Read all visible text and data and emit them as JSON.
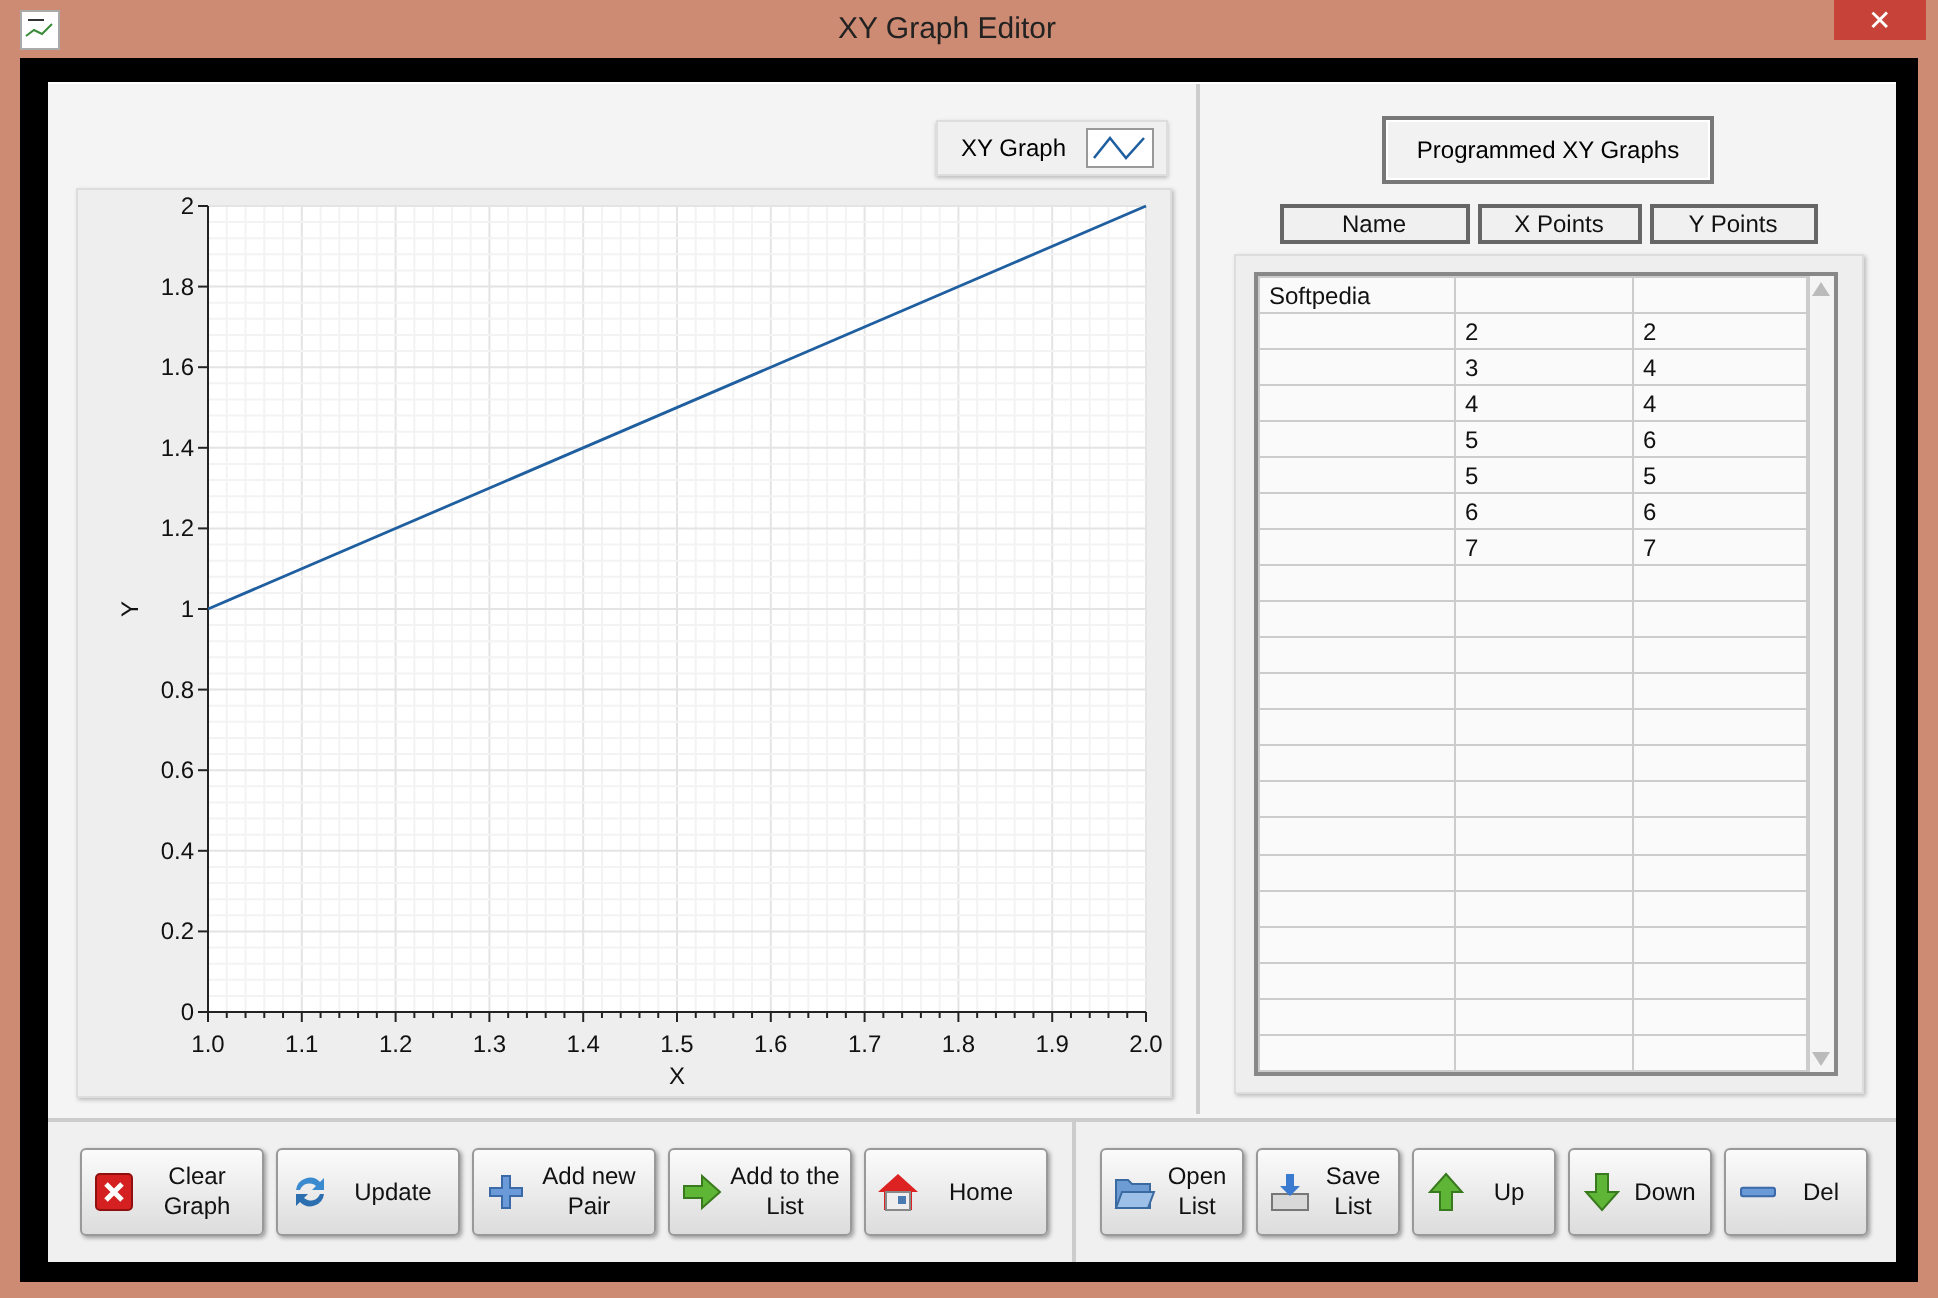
{
  "window": {
    "title": "XY Graph Editor",
    "close_button": "✕"
  },
  "graph": {
    "chart_data": {
      "type": "line",
      "grid": true,
      "xlabel": "X",
      "ylabel": "Y",
      "x": [
        1.0,
        2.0
      ],
      "series": [
        {
          "name": "XY Graph",
          "color": "#1f5fa0",
          "values": [
            1,
            2
          ]
        }
      ],
      "xlim": [
        1.0,
        2.0
      ],
      "ylim": [
        0,
        2
      ],
      "xticks": [
        {
          "value": 1.0,
          "label": "1.0"
        },
        {
          "value": 1.1,
          "label": "1.1"
        },
        {
          "value": 1.2,
          "label": "1.2"
        },
        {
          "value": 1.3,
          "label": "1.3"
        },
        {
          "value": 1.4,
          "label": "1.4"
        },
        {
          "value": 1.5,
          "label": "1.5"
        },
        {
          "value": 1.6,
          "label": "1.6"
        },
        {
          "value": 1.7,
          "label": "1.7"
        },
        {
          "value": 1.8,
          "label": "1.8"
        },
        {
          "value": 1.9,
          "label": "1.9"
        },
        {
          "value": 2.0,
          "label": "2.0"
        }
      ],
      "yticks": [
        0,
        0.2,
        0.4,
        0.6,
        0.8,
        1,
        1.2,
        1.4,
        1.6,
        1.8,
        2
      ]
    }
  },
  "list_panel": {
    "title_button": "Programmed XY Graphs",
    "columns": [
      "Name",
      "X Points",
      "Y Points"
    ],
    "rows": [
      [
        "Softpedia",
        "",
        ""
      ],
      [
        "",
        "2",
        "2"
      ],
      [
        "",
        "3",
        "4"
      ],
      [
        "",
        "4",
        "4"
      ],
      [
        "",
        "5",
        "6"
      ],
      [
        "",
        "5",
        "5"
      ],
      [
        "",
        "6",
        "6"
      ],
      [
        "",
        "7",
        "7"
      ]
    ]
  },
  "toolbar": {
    "left": [
      {
        "kind": "clear",
        "label": "Clear Graph"
      },
      {
        "kind": "update",
        "label": "Update"
      },
      {
        "kind": "add",
        "label": "Add new Pair"
      },
      {
        "kind": "addlist",
        "label": "Add to the List"
      },
      {
        "kind": "home",
        "label": "Home"
      }
    ],
    "right": [
      {
        "kind": "open",
        "label": "Open List"
      },
      {
        "kind": "save",
        "label": "Save List"
      },
      {
        "kind": "up",
        "label": "Up"
      },
      {
        "kind": "down",
        "label": "Down"
      },
      {
        "kind": "del",
        "label": "Del"
      }
    ]
  }
}
